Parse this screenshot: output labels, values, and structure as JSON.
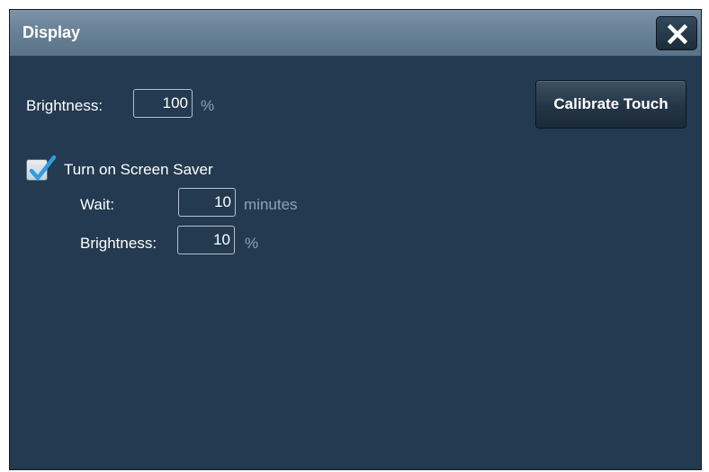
{
  "dialog": {
    "title": "Display",
    "close_icon": "close-icon"
  },
  "brightness": {
    "label": "Brightness:",
    "value": "100",
    "unit": "%"
  },
  "calibrate_button": {
    "label": "Calibrate Touch"
  },
  "screen_saver": {
    "checkbox_label": "Turn on Screen Saver",
    "checked": true,
    "wait": {
      "label": "Wait:",
      "value": "10",
      "unit": "minutes"
    },
    "brightness": {
      "label": "Brightness:",
      "value": "10",
      "unit": "%"
    }
  },
  "colors": {
    "dialog_background": "#233a50",
    "titlebar": "#6a8298",
    "checkmark": "#2f9be0",
    "unit_text": "#8fa3b5"
  }
}
